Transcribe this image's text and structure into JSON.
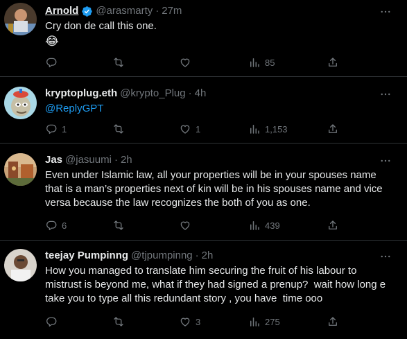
{
  "tweets": [
    {
      "name": "Arnold",
      "handle": "@arasmarty",
      "separator": "·",
      "time": "27m",
      "verified": true,
      "text": "Cry don de call this one.",
      "emoji": "😂",
      "replies": "",
      "retweets": "",
      "likes": "",
      "views": "85"
    },
    {
      "name": "kryptoplug.eth",
      "handle": "@krypto_Plug",
      "separator": "·",
      "time": "4h",
      "verified": false,
      "text": "@ReplyGPT",
      "replies": "1",
      "retweets": "",
      "likes": "1",
      "views": "1,153"
    },
    {
      "name": "Jas",
      "handle": "@jasuumi",
      "separator": "·",
      "time": "2h",
      "verified": false,
      "text": "Even under Islamic law, all your properties will be in your spouses name\nthat is a man’s properties next of kin will be in his spouses name and vice\nversa because the law recognizes the both of you as one.",
      "replies": "6",
      "retweets": "",
      "likes": "",
      "views": "439"
    },
    {
      "name": "teejay Pumpinng",
      "handle": "@tjpumpinng",
      "separator": "·",
      "time": "2h",
      "verified": false,
      "text": "How you managed to translate him securing the fruit of his labour to\nmistrust is beyond me, what if they had signed a prenup?  wait how long e\ntake you to type all this redundant story , you have  time ooo",
      "replies": "",
      "retweets": "",
      "likes": "3",
      "views": "275"
    }
  ],
  "colors": {
    "background": "#000000",
    "text": "#e7e9ea",
    "muted": "#71767b",
    "link": "#1d9bf0",
    "border": "#2f3336"
  },
  "icons": [
    "reply-icon",
    "retweet-icon",
    "like-icon",
    "views-icon",
    "share-icon",
    "more-icon",
    "verified-badge-icon"
  ]
}
